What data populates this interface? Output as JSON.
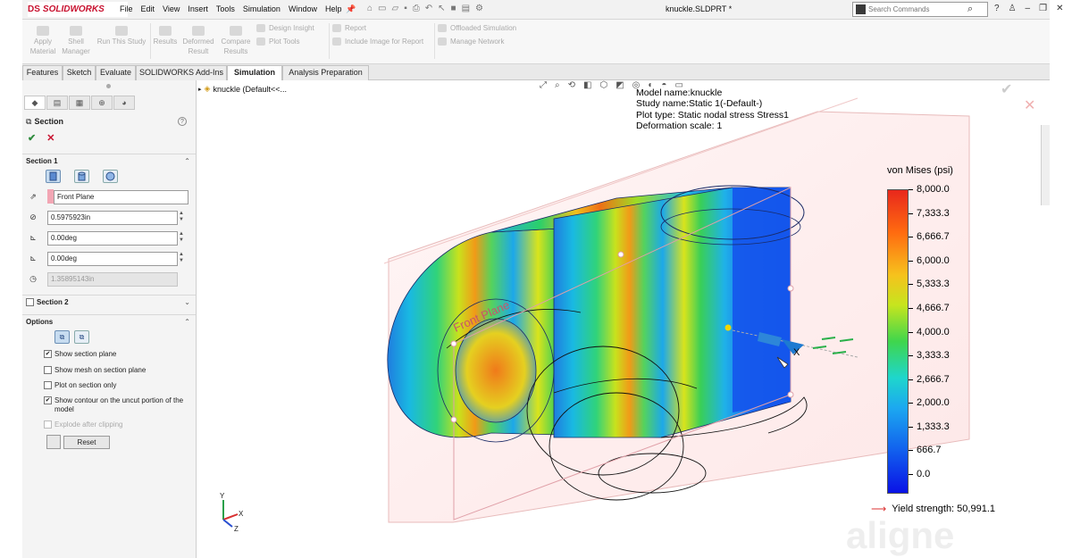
{
  "app": {
    "logo_ds": "DS",
    "logo_sw": "SOLIDWORKS",
    "doc_title": "knuckle.SLDPRT *"
  },
  "menus": [
    "File",
    "Edit",
    "View",
    "Insert",
    "Tools",
    "Simulation",
    "Window",
    "Help"
  ],
  "search": {
    "placeholder": "Search Commands"
  },
  "ribbon": {
    "apply_material": "Apply\nMaterial",
    "shell_manager": "Shell\nManager",
    "run_study": "Run This Study",
    "results": "Results",
    "deformed_result": "Deformed\nResult",
    "compare_results": "Compare\nResults",
    "design_insight": "Design Insight",
    "plot_tools": "Plot Tools",
    "report": "Report",
    "include_image": "Include Image for Report",
    "offloaded_sim": "Offloaded Simulation",
    "manage_network": "Manage Network"
  },
  "tabs": [
    "Features",
    "Sketch",
    "Evaluate",
    "SOLIDWORKS Add-Ins",
    "Simulation",
    "Analysis Preparation"
  ],
  "panel": {
    "title": "Section",
    "section1": "Section 1",
    "plane": "Front Plane",
    "offset": "0.5975923in",
    "angle1": "0.00deg",
    "angle2": "0.00deg",
    "radius": "1.35895143in",
    "section2": "Section 2",
    "options": "Options",
    "opt_show_plane": "Show section plane",
    "opt_show_mesh": "Show mesh on section plane",
    "opt_plot_only": "Plot on section only",
    "opt_contour": "Show contour on the uncut portion of the model",
    "opt_explode": "Explode after clipping",
    "reset": "Reset"
  },
  "tree": {
    "node": "knuckle  (Default<<..."
  },
  "model_info": {
    "line1": "Model name:knuckle",
    "line2": "Study name:Static 1(-Default-)",
    "line3": "Plot type: Static nodal stress Stress1",
    "line4": "Deformation scale: 1"
  },
  "legend": {
    "title": "von Mises (psi)",
    "values": [
      "8,000.0",
      "7,333.3",
      "6,666.7",
      "6,000.0",
      "5,333.3",
      "4,666.7",
      "4,000.0",
      "3,333.3",
      "2,666.7",
      "2,000.0",
      "1,333.3",
      "666.7",
      "0.0"
    ],
    "yield": "Yield strength: 50,991.1"
  },
  "viewport": {
    "plane_label": "Front Plane",
    "axis_x": "X",
    "triad_y": "Y",
    "triad_x": "X",
    "triad_z": "Z",
    "watermark": "aligne"
  }
}
